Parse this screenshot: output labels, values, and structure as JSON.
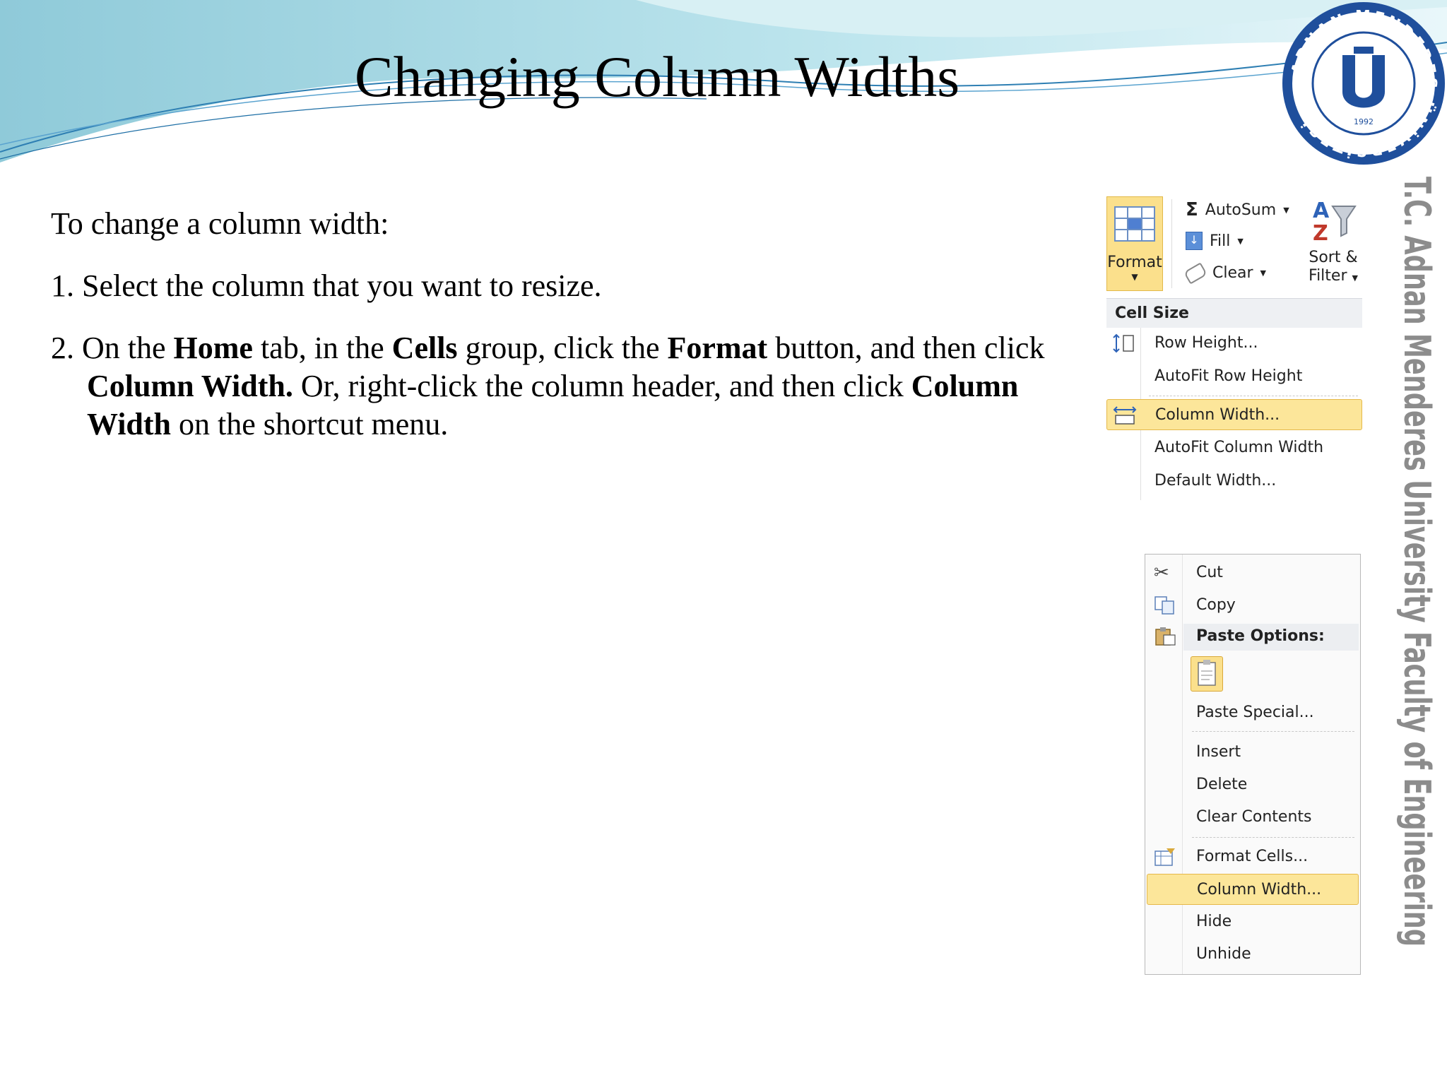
{
  "slide": {
    "title": "Changing Column Widths",
    "logo_text": "ADNAN MENDERES ÜNİVERSİTESİ",
    "logo_year": "1992",
    "side_text": "T.C.   Adnan Menderes University   Faculty of Engineering"
  },
  "body": {
    "intro": "To change a column width:",
    "step1": "1. Select the column that you want to resize.",
    "step2": {
      "p1": "2. On the ",
      "b1": "Home",
      "p2": " tab, in the ",
      "b2": "Cells",
      "p3": " group, click the ",
      "b3": "Format",
      "p4": " button, and then click ",
      "b4": "Column Width.",
      "p5": " Or, right-click the column header, and then click ",
      "b5": "Column Width",
      "p6": " on the shortcut menu."
    }
  },
  "ribbon": {
    "format_label": "Format",
    "autosum_label": "AutoSum",
    "fill_label": "Fill",
    "clear_label": "Clear",
    "sort_label_1": "Sort &",
    "sort_label_2": "Filter",
    "section_header": "Cell Size",
    "items": [
      {
        "label": "Row Height..."
      },
      {
        "label": "AutoFit Row Height"
      },
      {
        "label": "Column Width..."
      },
      {
        "label": "AutoFit Column Width"
      },
      {
        "label": "Default Width..."
      }
    ]
  },
  "context_menu": {
    "items": [
      {
        "label": "Cut"
      },
      {
        "label": "Copy"
      },
      {
        "label": "Paste Options:"
      },
      {
        "label": "Paste Special..."
      },
      {
        "label": "Insert"
      },
      {
        "label": "Delete"
      },
      {
        "label": "Clear Contents"
      },
      {
        "label": "Format Cells..."
      },
      {
        "label": "Column Width..."
      },
      {
        "label": "Hide"
      },
      {
        "label": "Unhide"
      }
    ]
  },
  "colors": {
    "banner_light": "#bfe4ea",
    "banner_mid": "#7fc4d4",
    "highlight": "#fce69a",
    "logo_blue": "#1f4f9c"
  }
}
